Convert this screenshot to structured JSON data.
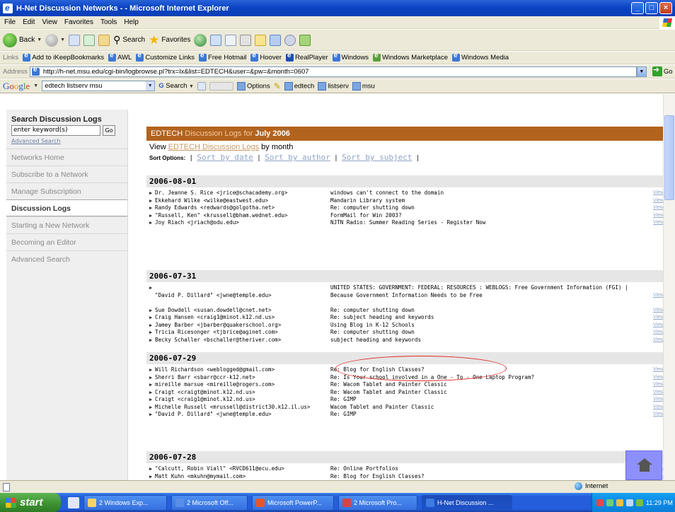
{
  "window": {
    "title": "H-Net Discussion Networks - - Microsoft Internet Explorer"
  },
  "menu": [
    "File",
    "Edit",
    "View",
    "Favorites",
    "Tools",
    "Help"
  ],
  "toolbar": {
    "back": "Back",
    "search": "Search",
    "favorites": "Favorites"
  },
  "links": {
    "label": "Links",
    "items": [
      "Add to iKeepBookmarks",
      "AWL",
      "Customize Links",
      "Free Hotmail",
      "Hoover",
      "RealPlayer",
      "Windows",
      "Windows Marketplace",
      "Windows Media"
    ]
  },
  "address": {
    "label": "Address",
    "url": "http://h-net.msu.edu/cgi-bin/logbrowse.pl?trx=lx&list=EDTECH&user=&pw=&month=0607",
    "go": "Go"
  },
  "google": {
    "logo": "Google",
    "query": "edtech listserv msu",
    "search": "Search",
    "options": "Options",
    "b1": "edtech",
    "b2": "listserv",
    "b3": "msu"
  },
  "sidebar": {
    "search_title": "Search Discussion Logs",
    "search_placeholder": "enter keyword(s)",
    "go": "Go",
    "advanced": "Advanced Search",
    "items": [
      {
        "label": "Networks Home"
      },
      {
        "label": "Subscribe to a Network"
      },
      {
        "label": "Manage Subscription"
      },
      {
        "label": "Discussion Logs"
      },
      {
        "label": "Starting a New Network"
      },
      {
        "label": "Becoming an Editor"
      },
      {
        "label": "Advanced Search"
      }
    ]
  },
  "main": {
    "header_list": "EDTECH",
    "header_mid": "Discussion Logs for",
    "header_month": "July 2006",
    "view_prefix": "View",
    "view_link": "EDTECH Discussion Logs",
    "view_suffix": "by month",
    "sort_label": "Sort Options:",
    "sort_date": "Sort by date",
    "sort_author": "Sort by author",
    "sort_subject": "Sort by subject",
    "view_label": "View"
  },
  "groups": [
    {
      "date": "2006-08-01",
      "rows": [
        {
          "who": "Dr. Jeanne S. Rice <jrice@schacademy.org>",
          "subj": "windows can't connect to the domain"
        },
        {
          "who": "Ekkehard Wilke <wilke@eastwest.edu>",
          "subj": "Mandarin Library system"
        },
        {
          "who": "Randy Edwards <redwards@golgotha.net>",
          "subj": "Re: computer shutting down"
        },
        {
          "who": "\"Russell, Ken\" <krussell@bham.wednet.edu>",
          "subj": "FormMail for Win 2003?"
        },
        {
          "who": "Joy Riach <jriach@odu.edu>",
          "subj": "NJTN Radio: Summer Reading Series - Register Now"
        }
      ]
    },
    {
      "date": "2006-07-31",
      "rows": [
        {
          "who": "\"David P. Dillard\" <jwne@temple.edu>",
          "subj": "UNITED STATES: GOVERNMENT: FEDERAL: RESOURCES : WEBLOGS: Free Government Information (FGI) | Because Government Information Needs to be Free"
        },
        {
          "who": "Sue Dowdell <susan.dowdell@cnet.net>",
          "subj": "Re: computer shutting down"
        },
        {
          "who": "Craig Hansen <craig1@minot.k12.nd.us>",
          "subj": "Re: subject heading and keywords"
        },
        {
          "who": "Jamey Barber <jbarber@quakerschool.org>",
          "subj": "Using Blog in K-12 Schools"
        },
        {
          "who": "Tricia Ricesonger <tjbrice@aginet.com>",
          "subj": "Re: computer shutting down"
        },
        {
          "who": "Becky Schaller <bschaller@theriver.com>",
          "subj": "subject heading and keywords"
        }
      ]
    },
    {
      "date": "2006-07-29",
      "rows": [
        {
          "who": "Will Richardson <weblogged@gmail.com>",
          "subj": "Re: Blog for English Classes?"
        },
        {
          "who": "Sherri Barr <sbarr@ccr-k12.net>",
          "subj": "Re: Is Your school involved in a One - To - One Laptop Program?"
        },
        {
          "who": "mireille marsue <mireille@rogers.com>",
          "subj": "Re: Wacom Tablet and Painter Classic"
        },
        {
          "who": "Craigt <craigt@minot.k12.nd.us>",
          "subj": "Re: Wacom Tablet and Painter Classic"
        },
        {
          "who": "Craigt <craig1@minot.k12.nd.us>",
          "subj": "Re: GIMP"
        },
        {
          "who": "Michelle Russell <mrussell@district30.k12.il.us>",
          "subj": "Wacom Tablet and Painter Classic"
        },
        {
          "who": "\"David P. Dillard\" <jwne@temple.edu>",
          "subj": "Re: GIMP"
        }
      ]
    },
    {
      "date": "2006-07-28",
      "rows": [
        {
          "who": "\"Calcutt, Robin Viall\" <RVCD611@ecu.edu>",
          "subj": "Re: Online Portfolios"
        },
        {
          "who": "Matt Kuhn <mkuhn@mymail.com>",
          "subj": "Re: Blog for English Classes?"
        }
      ]
    }
  ],
  "status": {
    "zone": "Internet"
  },
  "taskbar": {
    "start": "start",
    "tasks": [
      "2 Windows Exp...",
      "2 Microsoft Off...",
      "Microsoft PowerP...",
      "2 Microsoft Pro...",
      "H-Net Discussion ..."
    ],
    "clock": "11:29 PM"
  },
  "colors": {
    "header_bar": "#b2631e",
    "title_bar": "#0a44c4",
    "annotation_oval": "#e02a24",
    "home_button": "#8d8ffb"
  }
}
